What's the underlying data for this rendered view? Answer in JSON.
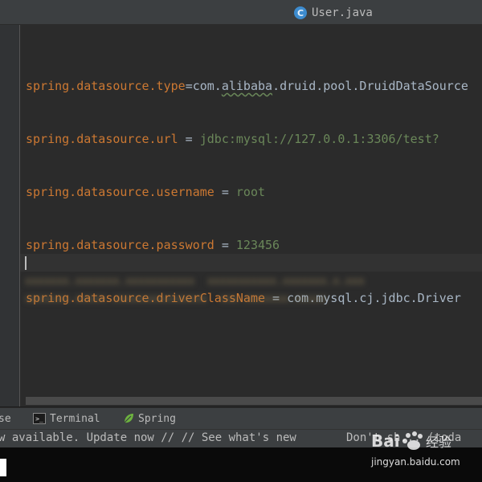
{
  "tab": {
    "icon": "java-class-icon",
    "icon_letter": "C",
    "label": "User.java"
  },
  "editor": {
    "lines": [
      {
        "key": "spring.datasource.type",
        "sep": "=",
        "value": "com.alibaba.druid.pool.DruidDataSource"
      },
      {
        "key": "spring.datasource.url",
        "sep": " = ",
        "value": "jdbc:mysql://127.0.0.1:3306/test?"
      },
      {
        "key": "spring.datasource.username",
        "sep": " = ",
        "value": "root"
      },
      {
        "key": "spring.datasource.password",
        "sep": " = ",
        "value": "123456"
      },
      {
        "key": "spring.datasource.driverClassName",
        "sep": " = ",
        "value": "com.mysql.cj.jdbc.Driver"
      }
    ]
  },
  "tool_windows": {
    "partial_label": "se",
    "terminal_label": "Terminal",
    "spring_label": "Spring"
  },
  "status": {
    "message": "w available. Update now // // See what's new",
    "right_text": "Don't sh... (toda"
  },
  "colors": {
    "key": "#cc7832",
    "value": "#6a8759",
    "editor_bg": "#2b2b2b",
    "panel_bg": "#3c3f41"
  },
  "watermark": {
    "url": "jingyan.baidu.com"
  }
}
